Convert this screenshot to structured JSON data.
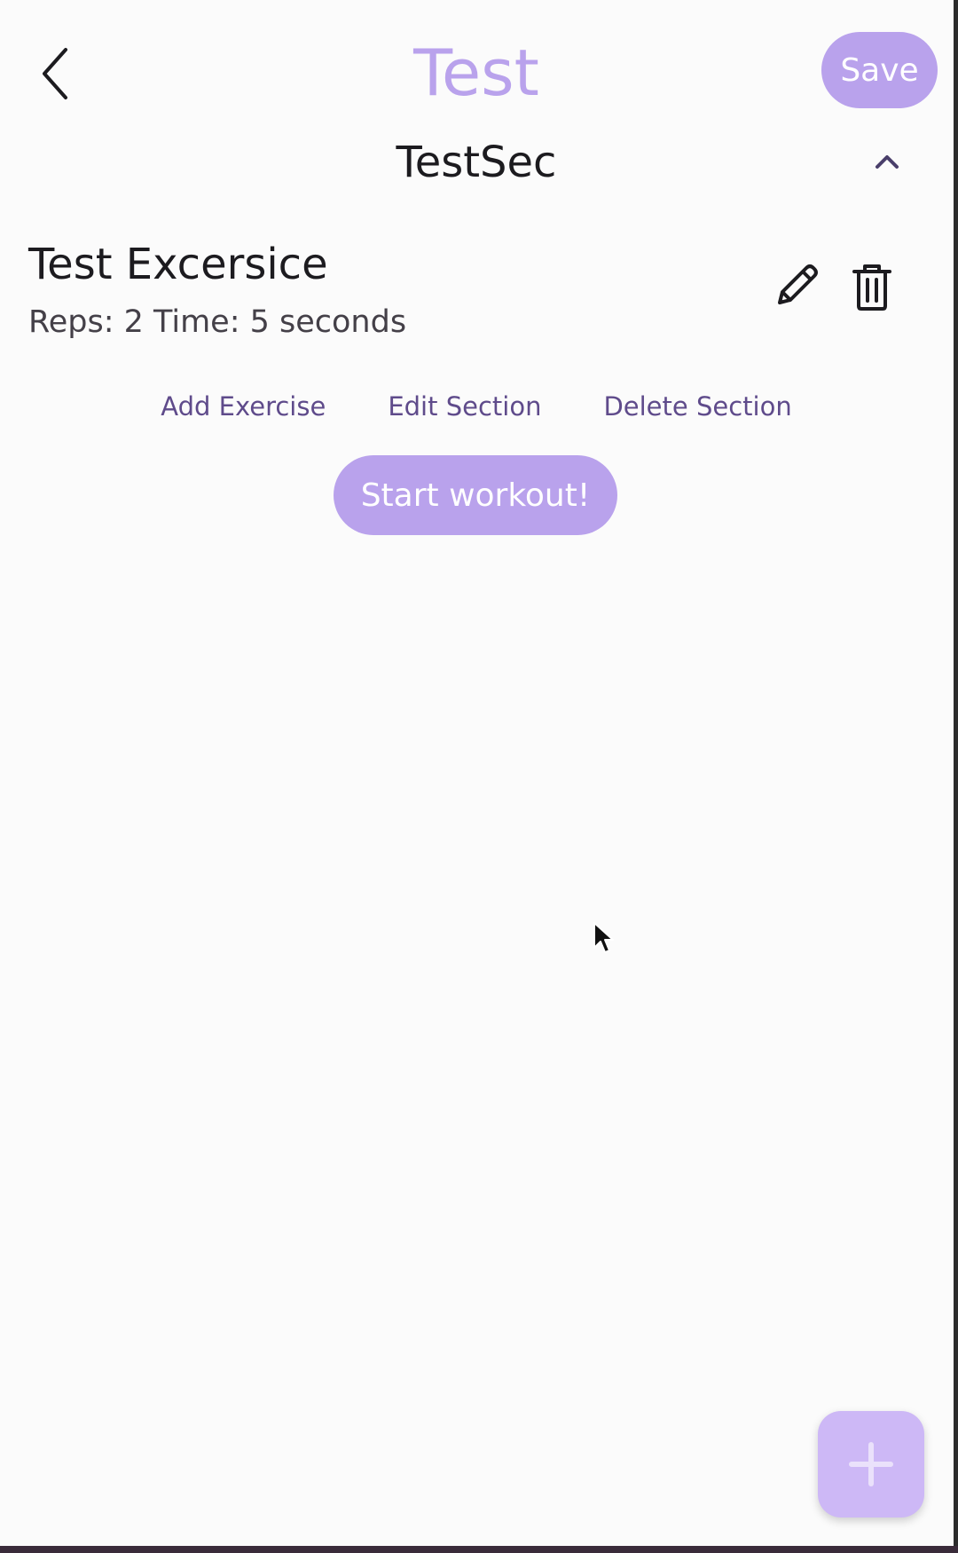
{
  "header": {
    "title": "Test",
    "save_label": "Save",
    "back_icon": "chevron-left-icon"
  },
  "section": {
    "title": "TestSec",
    "collapse_icon": "chevron-up-icon",
    "exercises": [
      {
        "name": "Test Excersice",
        "detail": "Reps: 2 Time: 5 seconds",
        "edit_icon": "pencil-icon",
        "delete_icon": "trash-icon"
      }
    ],
    "actions": {
      "add_exercise": "Add Exercise",
      "edit_section": "Edit Section",
      "delete_section": "Delete Section"
    },
    "start_label": "Start workout!"
  },
  "fab": {
    "icon": "plus-icon"
  },
  "colors": {
    "accent": "#b9a2ec",
    "fab": "#cdb8f6",
    "link": "#5f4b8b",
    "text": "#1c1b1f",
    "background": "#fbfbfb"
  }
}
